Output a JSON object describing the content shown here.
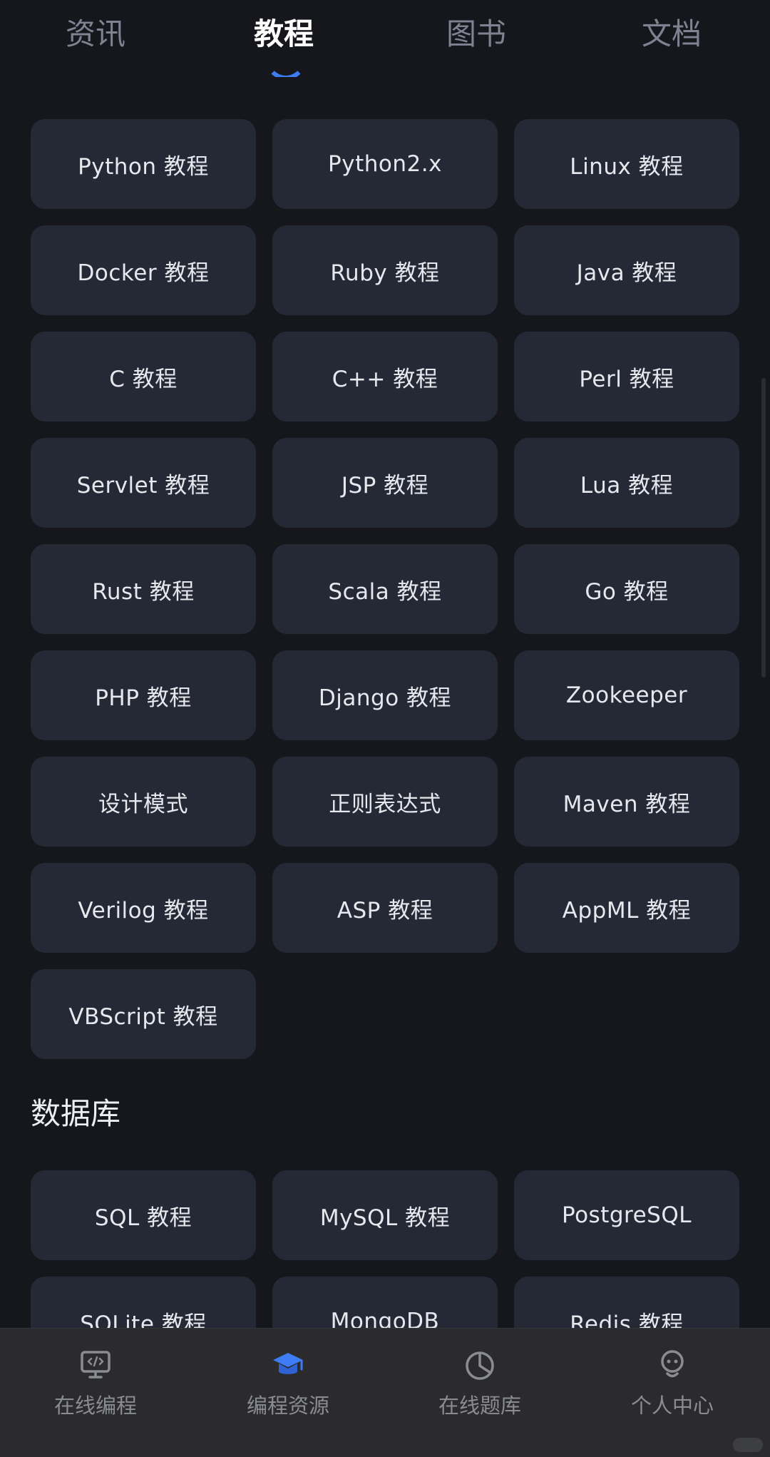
{
  "tabs": [
    {
      "label": "资讯",
      "active": false
    },
    {
      "label": "教程",
      "active": true
    },
    {
      "label": "图书",
      "active": false
    },
    {
      "label": "文档",
      "active": false
    }
  ],
  "tutorials": [
    "Python 教程",
    "Python2.x",
    "Linux 教程",
    "Docker 教程",
    "Ruby 教程",
    "Java 教程",
    "C 教程",
    "C++ 教程",
    "Perl 教程",
    "Servlet 教程",
    "JSP 教程",
    "Lua 教程",
    "Rust 教程",
    "Scala 教程",
    "Go 教程",
    "PHP 教程",
    "Django 教程",
    "Zookeeper",
    "设计模式",
    "正则表达式",
    "Maven 教程",
    "Verilog 教程",
    "ASP 教程",
    "AppML 教程",
    "VBScript 教程"
  ],
  "database": {
    "title": "数据库",
    "items": [
      "SQL 教程",
      "MySQL 教程",
      "PostgreSQL",
      "SQLite 教程",
      "MongoDB",
      "Redis 教程"
    ]
  },
  "bottom_nav": [
    {
      "label": "在线编程",
      "icon": "monitor-code-icon",
      "active": false
    },
    {
      "label": "编程资源",
      "icon": "graduation-cap-icon",
      "active": true
    },
    {
      "label": "在线题库",
      "icon": "pie-chart-icon",
      "active": false
    },
    {
      "label": "个人中心",
      "icon": "user-profile-icon",
      "active": false
    }
  ],
  "colors": {
    "background": "#15171d",
    "card": "#252935",
    "accent": "#3d7cf5",
    "nav_background": "#2b2b2d"
  }
}
